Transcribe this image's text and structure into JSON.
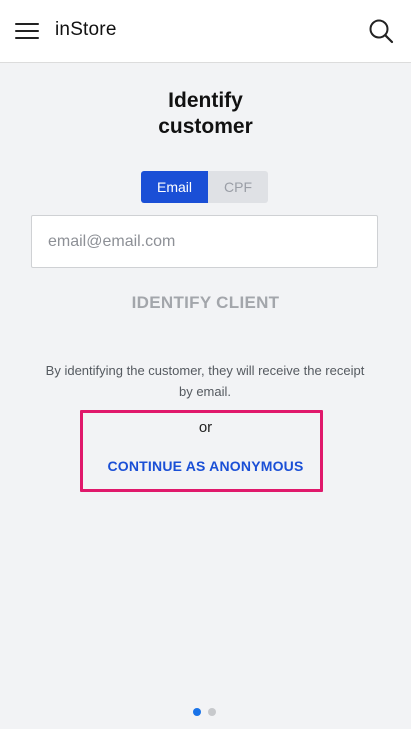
{
  "header": {
    "title": "inStore",
    "menu_icon": "hamburger-menu-icon",
    "search_icon": "search-icon"
  },
  "main": {
    "title_line1": "Identify",
    "title_line2": "customer",
    "toggle": {
      "options": [
        "Email",
        "CPF"
      ],
      "selected": "Email"
    },
    "email_input": {
      "value": "",
      "placeholder": "email@email.com"
    },
    "identify_button": "IDENTIFY CLIENT",
    "info_text": "By identifying the customer, they will receive the receipt by email.",
    "or_text": "or",
    "anonymous_link": "CONTINUE AS ANONYMOUS"
  },
  "pager": {
    "total": 2,
    "active": 1
  },
  "colors": {
    "accent": "#1a4fd6",
    "highlight": "#e0186b",
    "background": "#f2f3f5",
    "disabled_text": "#a3a6ab"
  }
}
